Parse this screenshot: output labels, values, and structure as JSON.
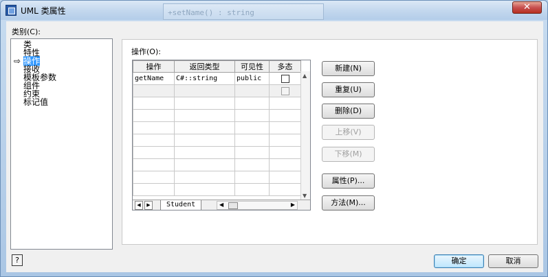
{
  "window": {
    "title": "UML 类属性",
    "close_glyph": "✕",
    "background_hint": "+setName() : string"
  },
  "categories": {
    "label": "类别(C):",
    "items": [
      {
        "label": "类",
        "selected": false
      },
      {
        "label": "特性",
        "selected": false
      },
      {
        "label": "操作",
        "selected": true
      },
      {
        "label": "接收",
        "selected": false
      },
      {
        "label": "模板参数",
        "selected": false
      },
      {
        "label": "组件",
        "selected": false
      },
      {
        "label": "约束",
        "selected": false
      },
      {
        "label": "标记值",
        "selected": false
      }
    ]
  },
  "operations": {
    "label": "操作(O):",
    "columns": [
      "操作",
      "返回类型",
      "可见性",
      "多态"
    ],
    "rows": [
      {
        "name": "getName",
        "return_type": "C#::string",
        "visibility": "public",
        "polymorphic": false
      }
    ],
    "tab": "Student"
  },
  "buttons": {
    "new": "新建(N)",
    "duplicate": "重复(U)",
    "delete": "删除(D)",
    "move_up": "上移(V)",
    "move_down": "下移(M)",
    "properties": "属性(P)...",
    "methods": "方法(M)..."
  },
  "footer": {
    "help_glyph": "?",
    "ok": "确定",
    "cancel": "取消"
  }
}
